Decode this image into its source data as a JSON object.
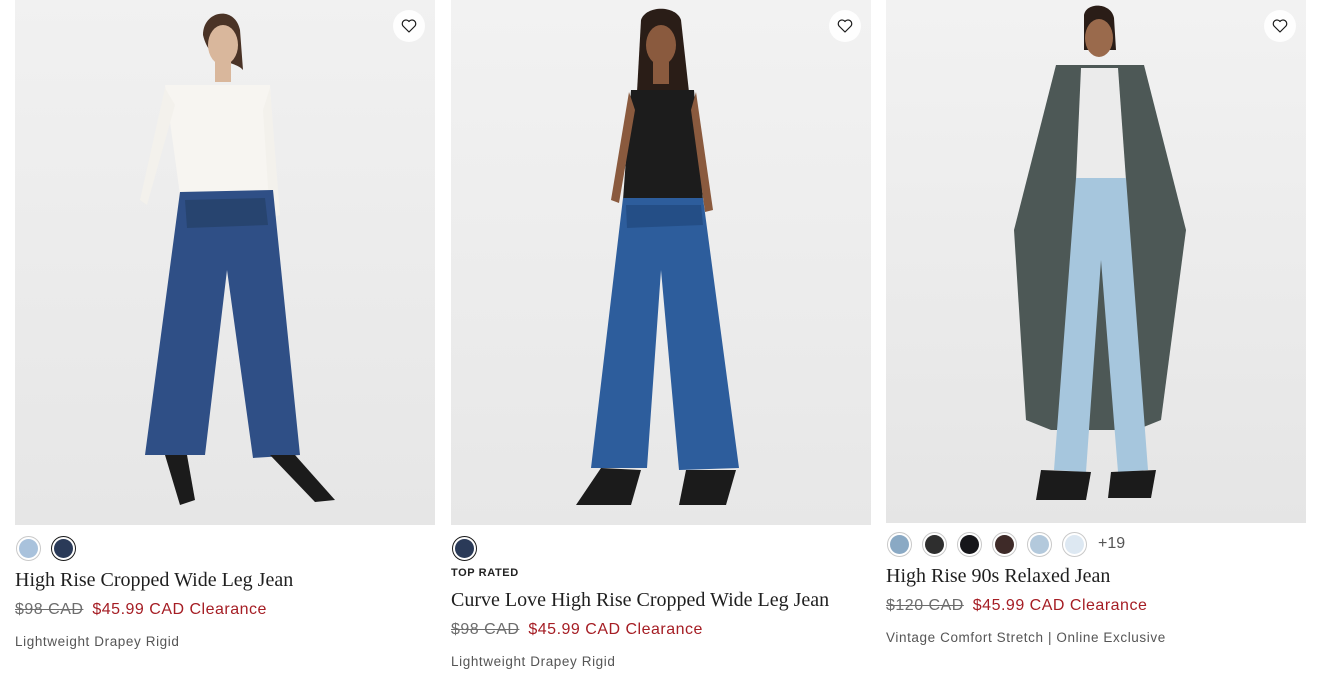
{
  "products": [
    {
      "badge": "",
      "name": "High Rise Cropped Wide Leg Jean",
      "original_price": "$98 CAD",
      "sale_price": "$45.99 CAD",
      "sale_label": "Clearance",
      "fit": "Lightweight Drapey Rigid",
      "swatches": [
        "#a9c2dc",
        "#2a3a58"
      ],
      "selected_swatch": 1,
      "more_colors": ""
    },
    {
      "badge": "TOP RATED",
      "name": "Curve Love High Rise Cropped Wide Leg Jean",
      "original_price": "$98 CAD",
      "sale_price": "$45.99 CAD",
      "sale_label": "Clearance",
      "fit": "Lightweight Drapey Rigid",
      "swatches": [
        "#2a3a58"
      ],
      "selected_swatch": 0,
      "more_colors": ""
    },
    {
      "badge": "",
      "name": "High Rise 90s Relaxed Jean",
      "original_price": "$120 CAD",
      "sale_price": "$45.99 CAD",
      "sale_label": "Clearance",
      "fit": "Vintage Comfort Stretch | Online Exclusive",
      "swatches": [
        "#8aa9c4",
        "#2e2e2e",
        "#16161a",
        "#3e2a28",
        "#b3c9dc",
        "#dde8f2"
      ],
      "selected_swatch": -1,
      "more_colors": "+19"
    }
  ],
  "icons": {
    "wishlist": "heart-outline-icon"
  },
  "colors": {
    "sale_red": "#a51d24",
    "photo_bg": "#ececec",
    "denim_dark": "#2f4f86",
    "denim_light": "#a6c6dd"
  }
}
